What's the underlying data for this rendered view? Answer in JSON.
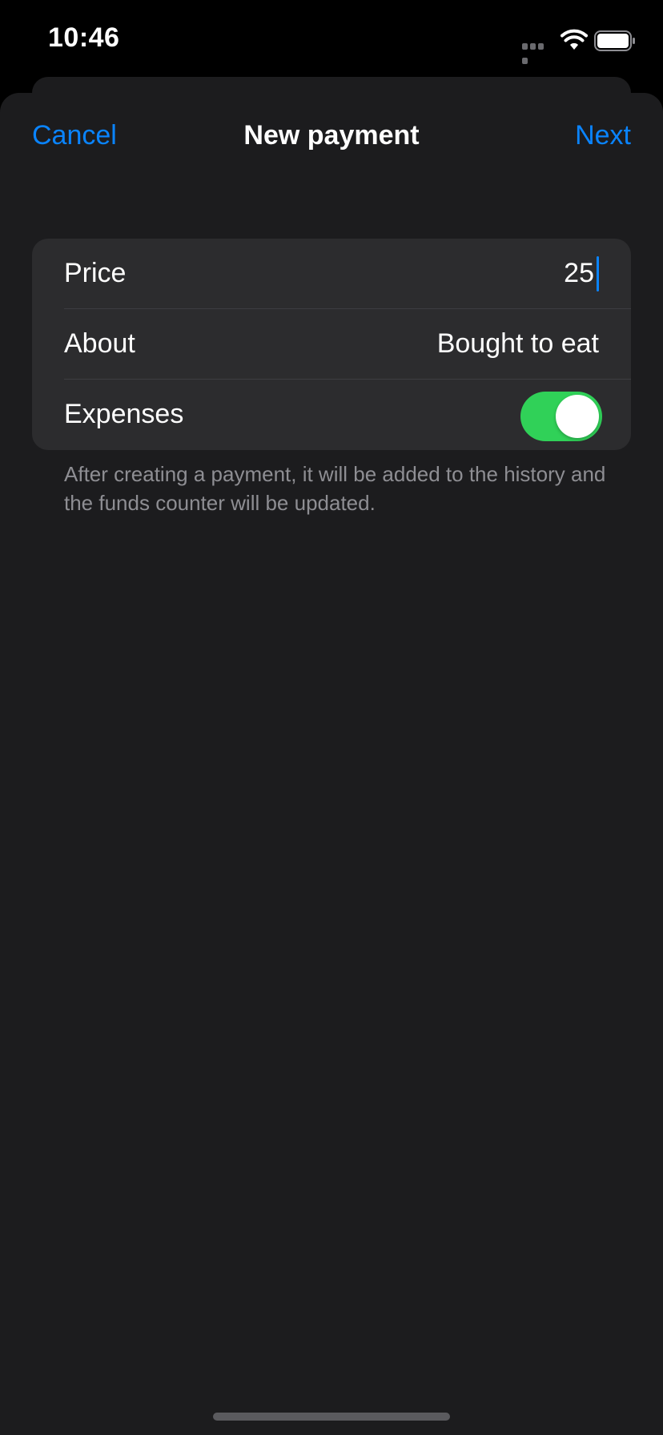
{
  "status_bar": {
    "time": "10:46",
    "icons": [
      "signal-icon",
      "wifi-icon",
      "battery-icon"
    ]
  },
  "nav": {
    "cancel_label": "Cancel",
    "title": "New payment",
    "next_label": "Next"
  },
  "form": {
    "rows": [
      {
        "label": "Price",
        "value": "25"
      },
      {
        "label": "About",
        "value": "Bought to eat"
      },
      {
        "label": "Expenses",
        "toggle_on": true
      }
    ],
    "footer": "After creating a payment, it will be added to the history and the funds counter will be updated."
  },
  "colors": {
    "accent": "#0a84ff",
    "toggle_on": "#30d158",
    "sheet_background": "#1c1c1e",
    "group_background": "#2c2c2e"
  }
}
